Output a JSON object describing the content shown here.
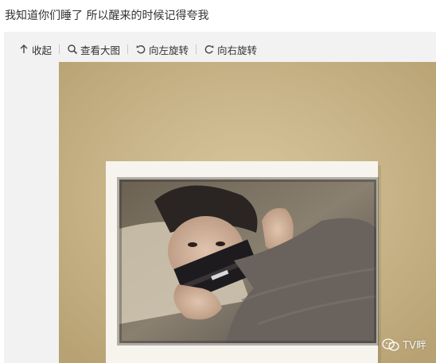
{
  "post": {
    "caption": "我知道你们睡了 所以醒来的时候记得夸我"
  },
  "toolbar": {
    "collapse_label": "收起",
    "view_large_label": "查看大图",
    "rotate_left_label": "向左旋转",
    "rotate_right_label": "向右旋转"
  },
  "image": {
    "watermark_text": "TV畔"
  },
  "colors": {
    "panel_bg": "#f2f2f2",
    "wall": "#cbb98e",
    "polaroid_border": "#f7f4ee",
    "text": "#333333"
  },
  "icons": [
    "arrow-up-icon",
    "magnifier-icon",
    "rotate-left-icon",
    "rotate-right-icon",
    "wechat-icon"
  ]
}
